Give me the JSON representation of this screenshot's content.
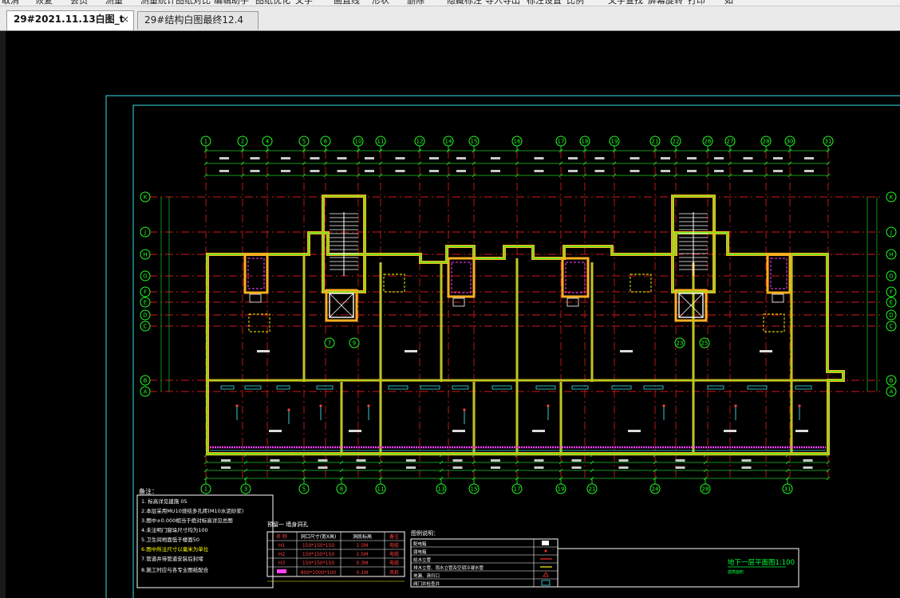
{
  "menu": {
    "items": [
      "取消",
      "恢复",
      "会员",
      "测量",
      "测量统计",
      "图纸对比",
      "编辑助手",
      "图纸优化",
      "文字",
      "画直线",
      "形状",
      "删除",
      "隐藏标注",
      "导入导出",
      "标注设置",
      "比例",
      "文字查找",
      "屏幕旋转",
      "打印",
      "如"
    ]
  },
  "tabs": [
    {
      "label": "29#2021.11.13白图_t",
      "active": true,
      "close_icon": "×"
    },
    {
      "label": "29#结构白图最终12.4",
      "active": false
    }
  ],
  "drawing": {
    "axis_top": [
      "1",
      "2",
      "4",
      "5",
      "6",
      "10",
      "11",
      "12",
      "14",
      "15",
      "16",
      "17",
      "18",
      "19",
      "21",
      "22",
      "26",
      "27",
      "28",
      "30",
      "31"
    ],
    "axis_bottom": [
      "1",
      "3",
      "5",
      "8",
      "11",
      "13",
      "15",
      "17",
      "19",
      "21",
      "24",
      "28",
      "31"
    ],
    "axis_side": [
      "K",
      "J",
      "H",
      "G",
      "F",
      "E",
      "D",
      "C",
      "B",
      "A"
    ],
    "axis_lift": [
      "7",
      "9",
      "23",
      "25"
    ],
    "notes_header": "备注：",
    "notes": [
      "1.   标高详见建施 05",
      "2.本层采用MU10烧结多孔砖(M10水泥砂浆)",
      "3.图中±0.000相当于绝对标高详见总图",
      "4.未注明门窗垛尺寸均为100",
      "5.卫生间地面低于楼面50",
      "6.图中所注尺寸以毫米为单位",
      "7.管道井待管道安装后封堵",
      "8.施工时应与各专业图纸配合"
    ],
    "hole_table_title": "预留一 墙身洞孔",
    "hole_table_headers": [
      "名 称",
      "洞口尺寸(宽X高)",
      "洞底标高",
      "备注"
    ],
    "hole_table_rows": [
      [
        "H1",
        "150*150*150",
        "1.5M",
        "电缆"
      ],
      [
        "H2",
        "150*150*150",
        "1.5M",
        "电缆"
      ],
      [
        "H3",
        "150*150*150",
        "0.3M",
        "电缆"
      ],
      [
        "H4",
        "800*1000*100",
        "0.1M",
        "风机"
      ]
    ],
    "legend_title": "图例说明：",
    "legend_rows": [
      "配电箱",
      "弱电箱",
      "给水立管",
      "排水立管、雨水立管及空调冷凝水管",
      "地漏、清扫口",
      "阀门井检查井"
    ],
    "plan_title": "地下一层平面图1:100",
    "plan_sub": "建筑面积"
  }
}
